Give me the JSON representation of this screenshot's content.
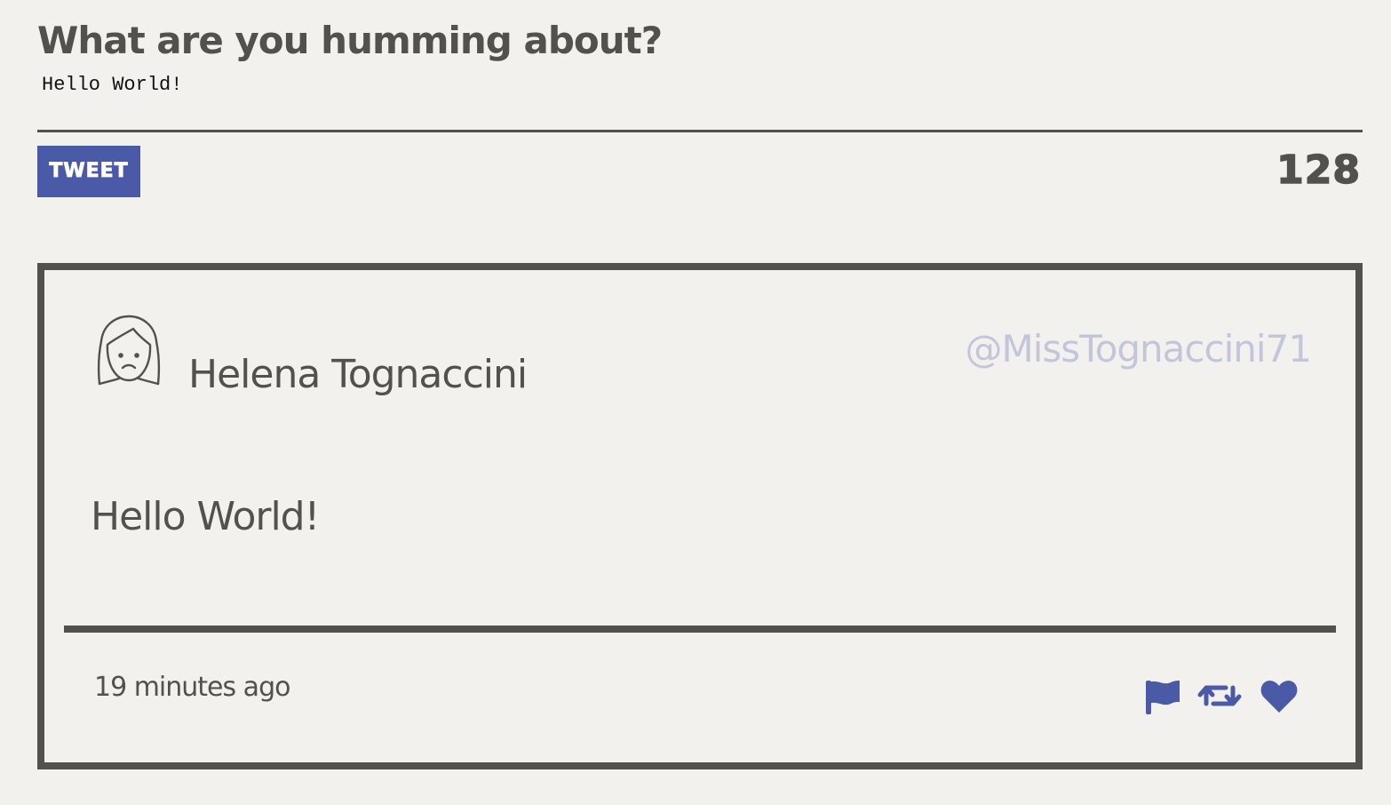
{
  "compose": {
    "title": "What are you humming about?",
    "input_value": "Hello World!",
    "tweet_button_label": "TWEET",
    "char_count": "128"
  },
  "tweet": {
    "user_name": "Helena Tognaccini",
    "handle": "@MissTognaccini71",
    "text": "Hello World!",
    "timestamp": "19 minutes ago",
    "actions": [
      "flag-icon",
      "retweet-icon",
      "heart-icon"
    ]
  },
  "colors": {
    "background": "#f2f1ed",
    "text": "#52514d",
    "accent": "#4a5aa6",
    "handle": "#c3c6db"
  }
}
